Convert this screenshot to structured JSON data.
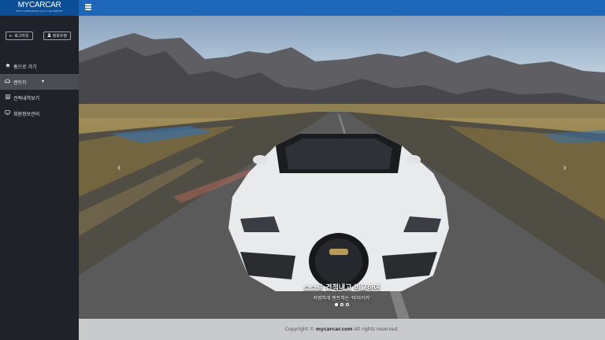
{
  "brand": {
    "logo": "MYCARCAR",
    "tagline": "BEST COMPARISON AUTO CAR SERVICE"
  },
  "auth": {
    "login_label": "로그아웃",
    "signup_label": "정보수정"
  },
  "sidebar": {
    "items": [
      {
        "label": "홈으로 가기",
        "icon": "home-icon"
      },
      {
        "label": "렌트카",
        "icon": "car-icon"
      },
      {
        "label": "견적내역보기",
        "icon": "list-icon"
      },
      {
        "label": "회원정보관리",
        "icon": "monitor-icon"
      }
    ]
  },
  "carousel": {
    "title": "스스로 견적내고 비교하여",
    "subtitle": "저렴하게 렌트하는 '마이카카'",
    "slide_count": 3,
    "active_index": 0,
    "prev_symbol": "‹",
    "next_symbol": "›"
  },
  "footer": {
    "prefix": "Copyright © ",
    "site": "mycarcar.com",
    "suffix": " All rights reserved."
  },
  "colors": {
    "topbar": "#1e66b8",
    "sidebar": "#1f2229",
    "footer": "#c9cacc"
  }
}
